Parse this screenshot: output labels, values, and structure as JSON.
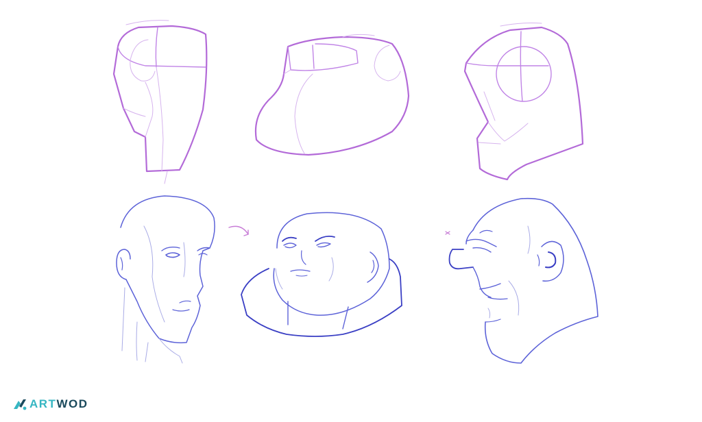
{
  "brand": {
    "name_part1": "ART",
    "name_part2": "WOD",
    "color_primary": "#35b6c2",
    "color_secondary": "#1b4a5c",
    "mark_icon": "artwod-logo-icon"
  },
  "palette": {
    "construction_stroke": "#c084e6",
    "finished_stroke": "#5c62d8",
    "background": "#ffffff"
  }
}
